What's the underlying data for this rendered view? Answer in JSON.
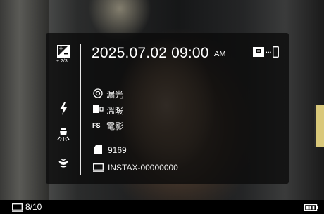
{
  "header": {
    "datetime": "2025.07.02  09:00",
    "ampm": "AM",
    "exposure_comp": "+ 2/3"
  },
  "settings": {
    "metering": "漏光",
    "white_balance": "溫暖",
    "film_sim_tag": "FS",
    "film_sim": "電影",
    "remaining_shots": "9169",
    "device_name": "INSTAX-00000000"
  },
  "status": {
    "counter": "8/10"
  },
  "icons": {
    "exposure": "exposure-compensation-icon",
    "flash": "flash-icon",
    "lamp": "self-timer-lamp-icon",
    "macro": "macro-flower-icon",
    "print": "print-icon",
    "phone": "smartphone-icon",
    "battery": "battery-icon"
  },
  "colors": {
    "panel": "#0a0a0a",
    "text": "#ffffff"
  }
}
